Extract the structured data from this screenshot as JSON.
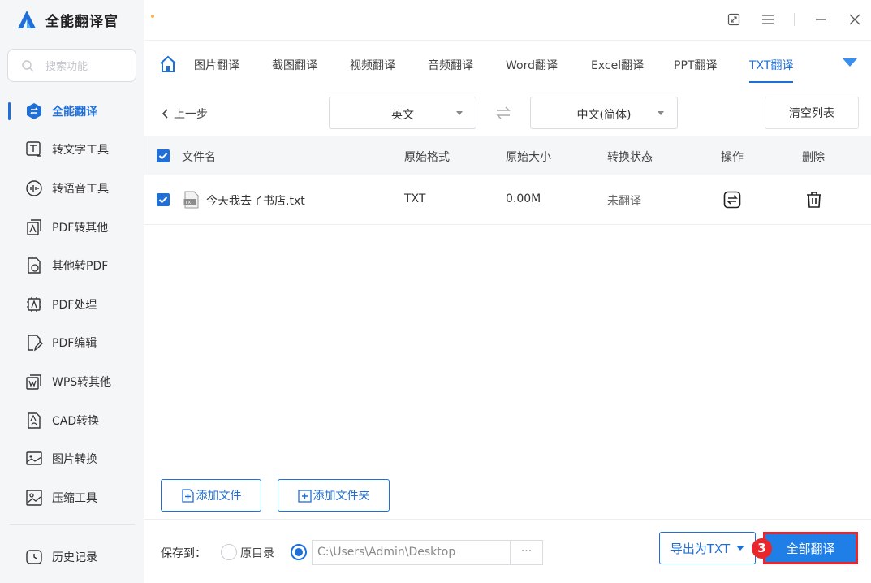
{
  "app": {
    "title": "全能翻译官"
  },
  "search": {
    "placeholder": "搜索功能"
  },
  "sidebar": {
    "items": [
      {
        "label": "全能翻译",
        "icon": "translate-icon",
        "active": true
      },
      {
        "label": "转文字工具",
        "icon": "text-convert-icon"
      },
      {
        "label": "转语音工具",
        "icon": "voice-icon"
      },
      {
        "label": "PDF转其他",
        "icon": "pdf-export-icon"
      },
      {
        "label": "其他转PDF",
        "icon": "pdf-import-icon"
      },
      {
        "label": "PDF处理",
        "icon": "pdf-process-icon"
      },
      {
        "label": "PDF编辑",
        "icon": "pdf-edit-icon"
      },
      {
        "label": "WPS转其他",
        "icon": "wps-icon"
      },
      {
        "label": "CAD转换",
        "icon": "cad-icon"
      },
      {
        "label": "图片转换",
        "icon": "image-convert-icon"
      },
      {
        "label": "压缩工具",
        "icon": "compress-icon"
      }
    ],
    "history": {
      "label": "历史记录",
      "icon": "history-icon"
    }
  },
  "tabs": [
    {
      "label": "图片翻译"
    },
    {
      "label": "截图翻译"
    },
    {
      "label": "视频翻译"
    },
    {
      "label": "音频翻译"
    },
    {
      "label": "Word翻译"
    },
    {
      "label": "Excel翻译"
    },
    {
      "label": "PPT翻译"
    },
    {
      "label": "TXT翻译",
      "active": true
    }
  ],
  "toolbar": {
    "back_label": "上一步",
    "source_lang": "英文",
    "target_lang": "中文(简体)",
    "clear_label": "清空列表"
  },
  "table": {
    "headers": {
      "name": "文件名",
      "format": "原始格式",
      "size": "原始大小",
      "status": "转换状态",
      "action": "操作",
      "delete": "删除"
    },
    "rows": [
      {
        "name": "今天我去了书店.txt",
        "format": "TXT",
        "size": "0.00M",
        "status": "未翻译"
      }
    ]
  },
  "buttons": {
    "add_file": "添加文件",
    "add_folder": "添加文件夹",
    "export": "导出为TXT",
    "translate_all": "全部翻译",
    "browse": "···"
  },
  "save": {
    "label": "保存到：",
    "option_original": "原目录",
    "path": "C:\\Users\\Admin\\Desktop"
  },
  "step_badge": "3",
  "colors": {
    "accent": "#1f6fd6",
    "highlight": "#e8262c",
    "sidebar_bg": "#f5f6f8"
  }
}
